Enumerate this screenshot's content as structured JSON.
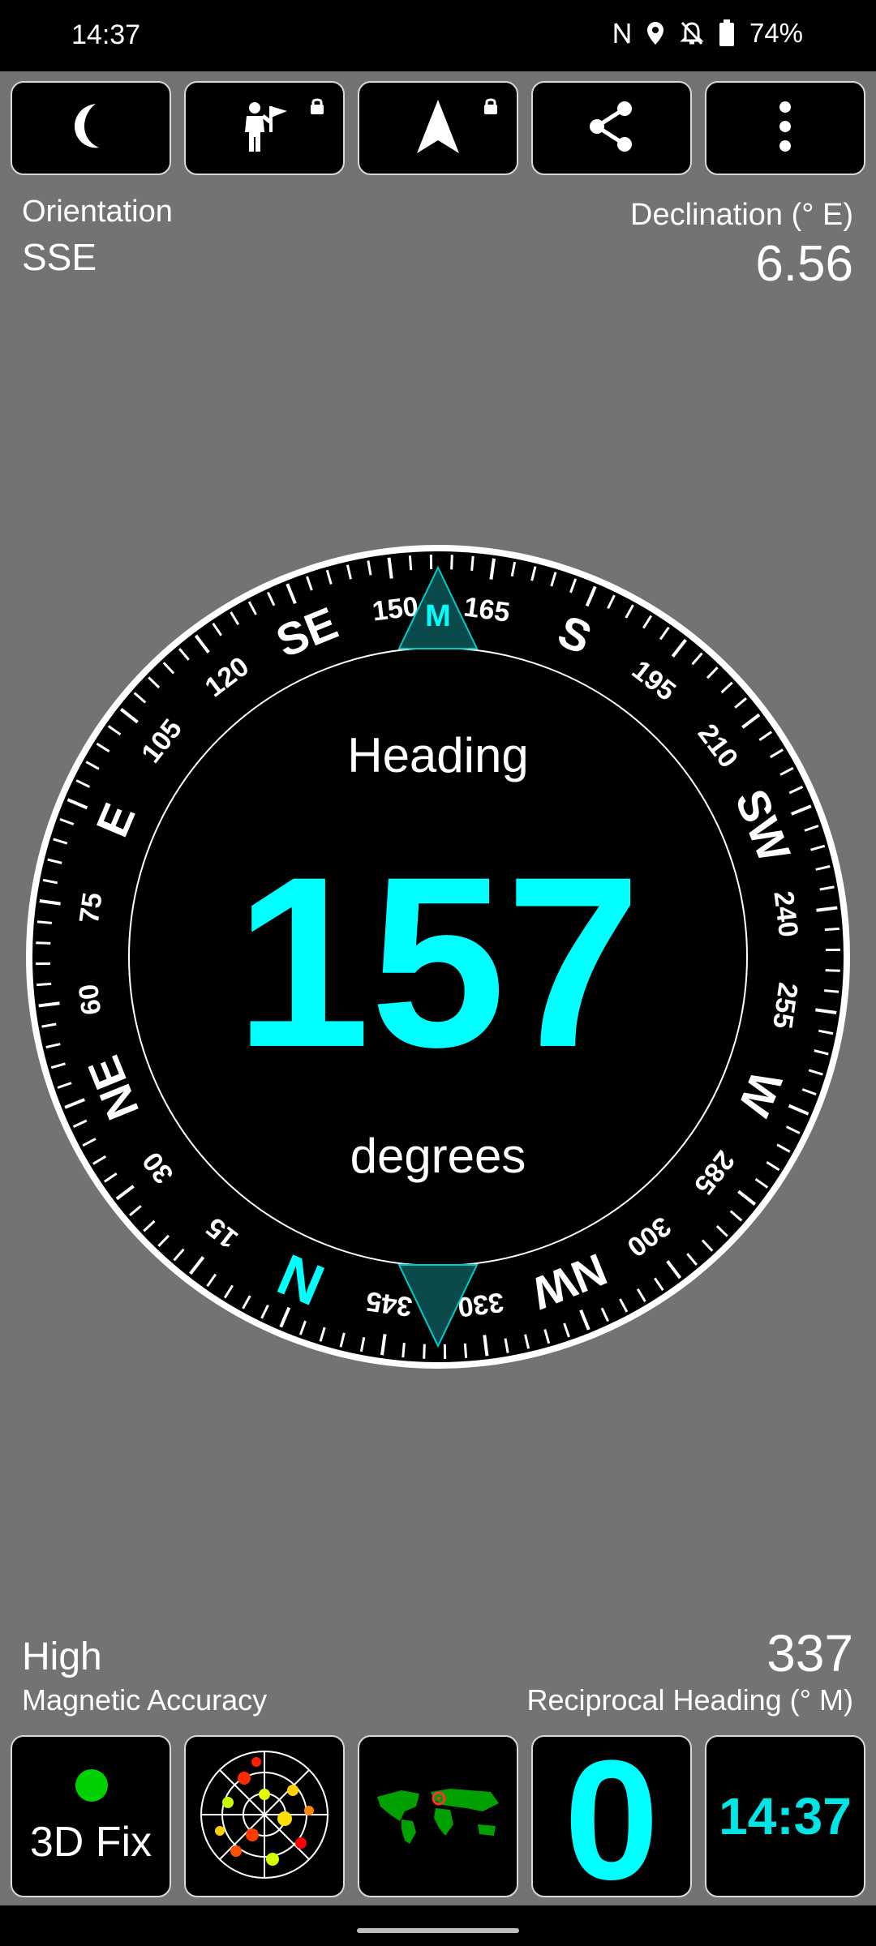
{
  "status_bar": {
    "time": "14:37",
    "battery": "74%"
  },
  "toolbar": {
    "buttons": [
      {
        "icon": "moon-icon"
      },
      {
        "icon": "person-flag-icon",
        "locked": true
      },
      {
        "icon": "navigation-arrow-icon",
        "locked": true
      },
      {
        "icon": "share-icon"
      },
      {
        "icon": "more-vert-icon"
      }
    ]
  },
  "orientation": {
    "label": "Orientation",
    "value": "SSE"
  },
  "declination": {
    "label": "Declination (° E)",
    "value": "6.56"
  },
  "compass": {
    "heading_label": "Heading",
    "heading_value": "157",
    "unit_label": "degrees",
    "marker_label": "M",
    "cardinals": [
      "N",
      "NE",
      "E",
      "SE",
      "S",
      "SW",
      "W",
      "NW"
    ],
    "degree_labels": [
      "15",
      "30",
      "60",
      "75",
      "105",
      "120",
      "150",
      "165",
      "195",
      "210",
      "240",
      "255",
      "285",
      "300",
      "330",
      "345"
    ],
    "accent_color": "#00ffff"
  },
  "accuracy": {
    "value": "High",
    "label": "Magnetic Accuracy"
  },
  "reciprocal": {
    "value": "337",
    "label": "Reciprocal Heading (° M)"
  },
  "bottom_bar": {
    "fix_status": "3D Fix",
    "fix_color": "#00d100",
    "satellites_count": "0",
    "clock": "14:37"
  }
}
